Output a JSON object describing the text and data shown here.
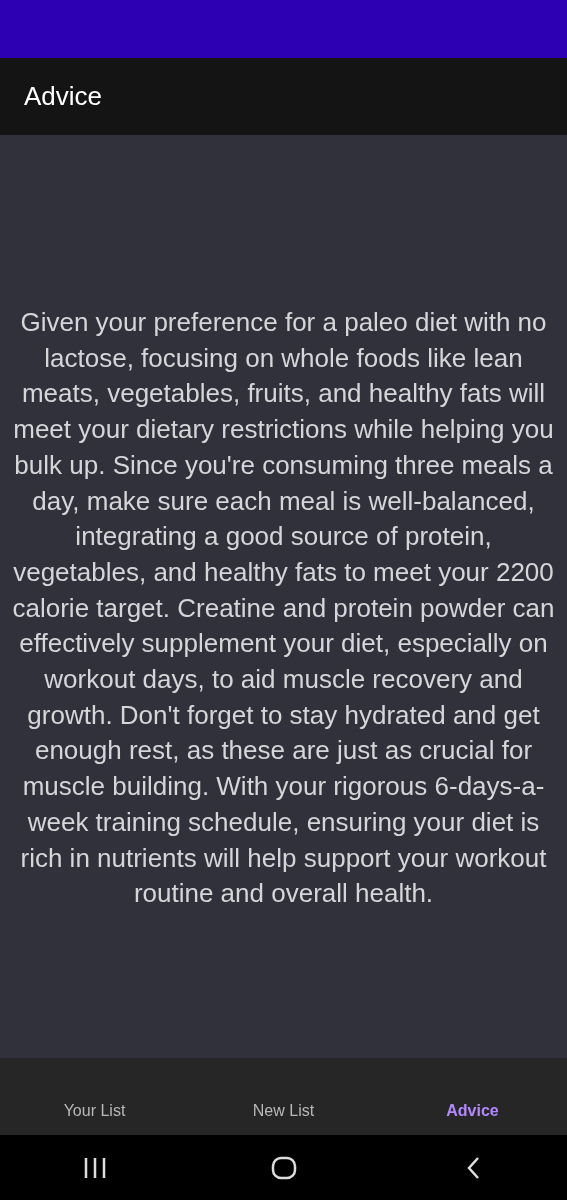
{
  "app_bar": {
    "title": "Advice"
  },
  "advice": {
    "text": "Given your preference for a paleo diet with no lactose, focusing on whole foods like lean meats, vegetables, fruits, and healthy fats will meet your dietary restrictions while helping you bulk up. Since you're consuming three meals a day, make sure each meal is well-balanced, integrating a good source of protein, vegetables, and healthy fats to meet your 2200 calorie target. Creatine and protein powder can effectively supplement your diet, especially on workout days, to aid muscle recovery and growth. Don't forget to stay hydrated and get enough rest, as these are just as crucial for muscle building. With your rigorous 6-days-a-week training schedule, ensuring your diet is rich in nutrients will help support your workout routine and overall health."
  },
  "bottom_nav": [
    {
      "label": "Your List",
      "selected": false
    },
    {
      "label": "New List",
      "selected": false
    },
    {
      "label": "Advice",
      "selected": true
    }
  ]
}
